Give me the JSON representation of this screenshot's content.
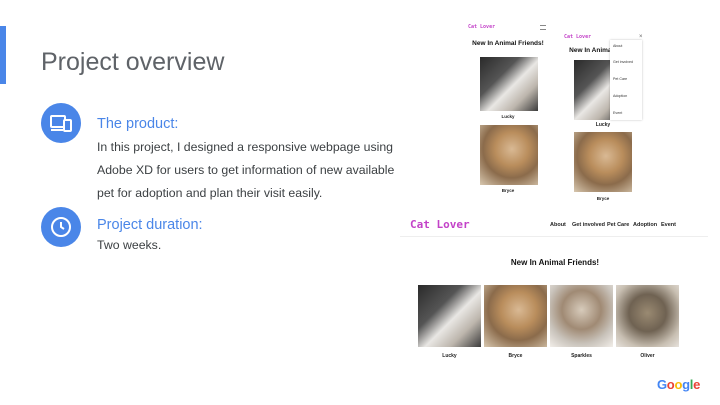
{
  "slide": {
    "title": "Project overview",
    "product": {
      "heading": "The product:",
      "body": "In this project, I designed a responsive webpage using Adobe XD for users to get information of new available pet for adoption and plan their visit easily."
    },
    "duration": {
      "heading": "Project duration:",
      "body": "Two weeks."
    },
    "footer_logo": "Google"
  },
  "mockups": {
    "brand": "Cat Lover",
    "heading": "New In Animal Friends!",
    "cats": [
      "Lucky",
      "Bryce",
      "Sparkles",
      "Oliver"
    ],
    "nav": [
      "About",
      "Get involved",
      "Pet Care",
      "Adoption",
      "Event"
    ],
    "mobile_menu_close": "×",
    "mobile_menu_icon": "hamburger-icon"
  },
  "colors": {
    "accent": "#4a86e8",
    "brand": "#c342c8"
  }
}
